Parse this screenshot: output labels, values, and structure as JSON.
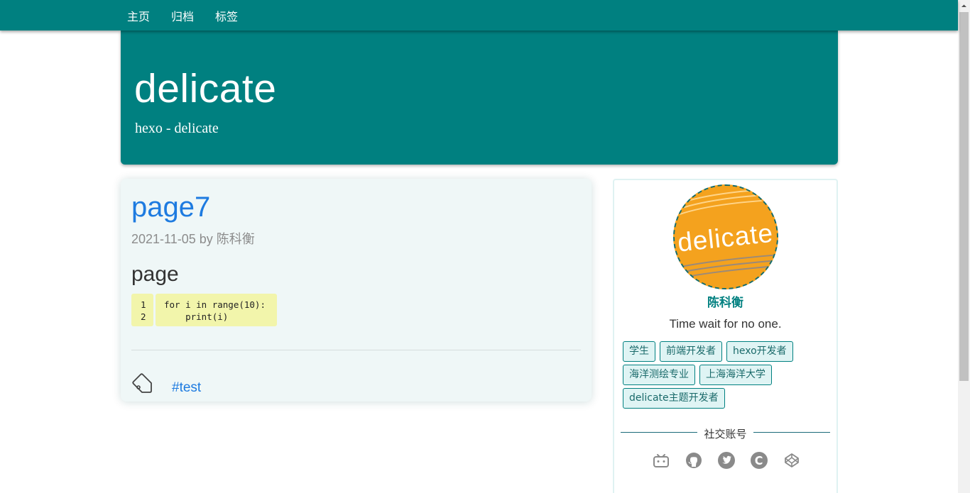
{
  "nav": {
    "links": [
      {
        "label": "主页"
      },
      {
        "label": "归档"
      },
      {
        "label": "标签"
      }
    ]
  },
  "hero": {
    "title": "delicate",
    "subtitle": "hexo - delicate"
  },
  "post": {
    "title": "page7",
    "meta": "2021-11-05 by 陈科衡",
    "heading": "page",
    "code": {
      "line_numbers": "1\n2",
      "text": "for i in range(10):\n    print(i)"
    },
    "tag": "#test",
    "tag_icon": "tag-icon"
  },
  "sidebar": {
    "avatar_text": "delicate",
    "author": "陈科衡",
    "motto": "Time wait for no one.",
    "tags": [
      "学生",
      "前端开发者",
      "hexo开发者",
      "海洋测绘专业",
      "上海海洋大学",
      "delicate主题开发者"
    ],
    "social_title": "社交账号",
    "social_icons": [
      "bilibili-icon",
      "github-icon",
      "twitter-icon",
      "csdn-icon",
      "codepen-icon"
    ]
  },
  "colors": {
    "primary": "#008080",
    "link": "#1e7be0",
    "card_bg": "#eff7f7",
    "code_bg": "#f2f5ab",
    "avatar_bg": "#f4a21e"
  }
}
